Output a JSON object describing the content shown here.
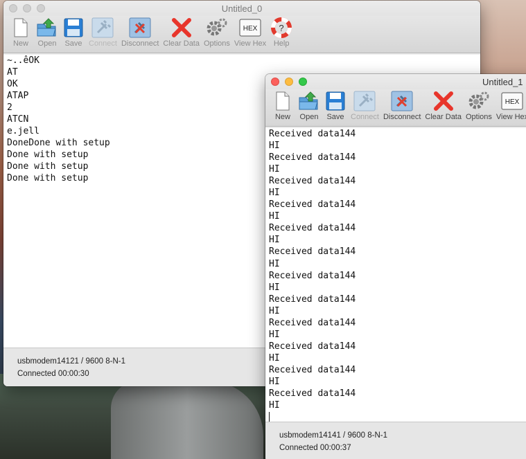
{
  "windows": [
    {
      "title": "Untitled_0",
      "toolbar": [
        {
          "label": "New",
          "icon": "new-document-icon",
          "enabled": true
        },
        {
          "label": "Open",
          "icon": "open-folder-icon",
          "enabled": true
        },
        {
          "label": "Save",
          "icon": "save-disk-icon",
          "enabled": true
        },
        {
          "label": "Connect",
          "icon": "connect-plug-icon",
          "enabled": false
        },
        {
          "label": "Disconnect",
          "icon": "disconnect-plug-icon",
          "enabled": true
        },
        {
          "label": "Clear Data",
          "icon": "clear-x-icon",
          "enabled": true
        },
        {
          "label": "Options",
          "icon": "gear-icon",
          "enabled": true
        },
        {
          "label": "View Hex",
          "icon": "hex-icon",
          "enabled": true
        },
        {
          "label": "Help",
          "icon": "lifebuoy-help-icon",
          "enabled": true
        }
      ],
      "terminal_lines": [
        "~..êOK",
        "AT",
        "OK",
        "ATAP",
        "2",
        "ATCN",
        "e.jell",
        "DoneDone with setup",
        "Done with setup",
        "Done with setup",
        "Done with setup"
      ],
      "status": {
        "port": "usbmodem14121 / 9600 8-N-1",
        "connection": "Connected 00:00:30"
      }
    },
    {
      "title": "Untitled_1",
      "toolbar": [
        {
          "label": "New",
          "icon": "new-document-icon",
          "enabled": true
        },
        {
          "label": "Open",
          "icon": "open-folder-icon",
          "enabled": true
        },
        {
          "label": "Save",
          "icon": "save-disk-icon",
          "enabled": true
        },
        {
          "label": "Connect",
          "icon": "connect-plug-icon",
          "enabled": false
        },
        {
          "label": "Disconnect",
          "icon": "disconnect-plug-icon",
          "enabled": true
        },
        {
          "label": "Clear Data",
          "icon": "clear-x-icon",
          "enabled": true
        },
        {
          "label": "Options",
          "icon": "gear-icon",
          "enabled": true
        },
        {
          "label": "View Hex",
          "icon": "hex-icon",
          "enabled": true
        }
      ],
      "terminal_lines": [
        "Received data144",
        "HI",
        "Received data144",
        "HI",
        "Received data144",
        "HI",
        "Received data144",
        "HI",
        "Received data144",
        "HI",
        "Received data144",
        "HI",
        "Received data144",
        "HI",
        "Received data144",
        "HI",
        "Received data144",
        "HI",
        "Received data144",
        "HI",
        "Received data144",
        "HI",
        "Received data144",
        "HI"
      ],
      "status": {
        "port": "usbmodem14141 / 9600 8-N-1",
        "connection": "Connected 00:00:37"
      }
    }
  ],
  "hex_icon_text": "HEX",
  "colors": {
    "clear_red": "#e8352b",
    "accent_blue": "#2a7fd4",
    "folder_green": "#3fa94a"
  }
}
